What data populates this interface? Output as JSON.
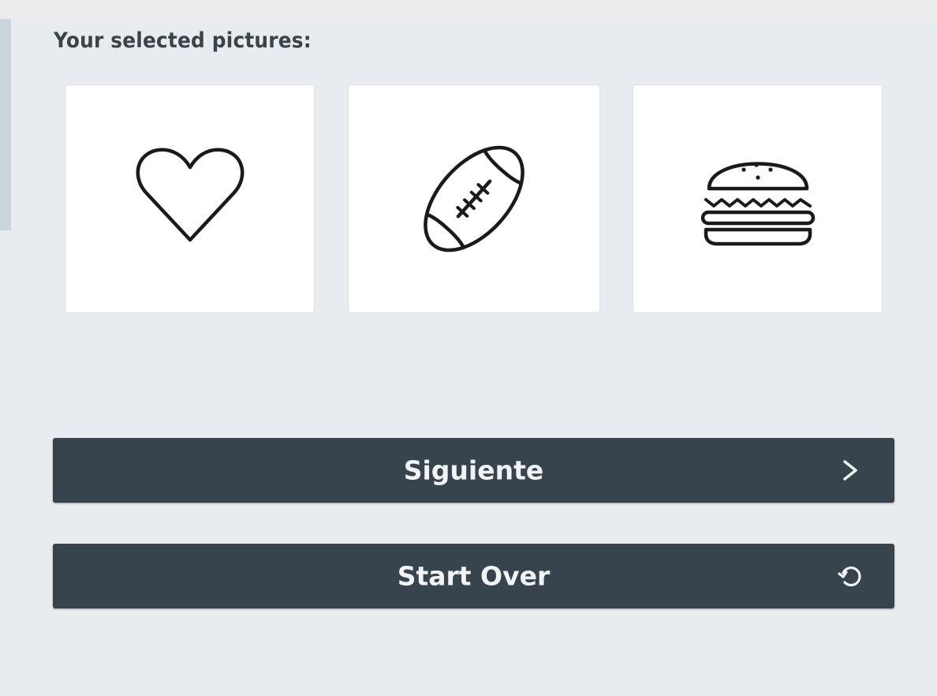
{
  "selection": {
    "heading": "Your selected pictures:",
    "pictures": [
      {
        "icon": "heart-icon"
      },
      {
        "icon": "football-icon"
      },
      {
        "icon": "hamburger-icon"
      }
    ]
  },
  "actions": {
    "next_label": "Siguiente",
    "next_icon": "chevron-right-icon",
    "start_over_label": "Start Over",
    "start_over_icon": "restart-icon"
  },
  "colors": {
    "background": "#e8ebef",
    "button": "#37444d",
    "button_text": "#f1f3f4",
    "heading_text": "#38434a",
    "card": "#ffffff"
  }
}
